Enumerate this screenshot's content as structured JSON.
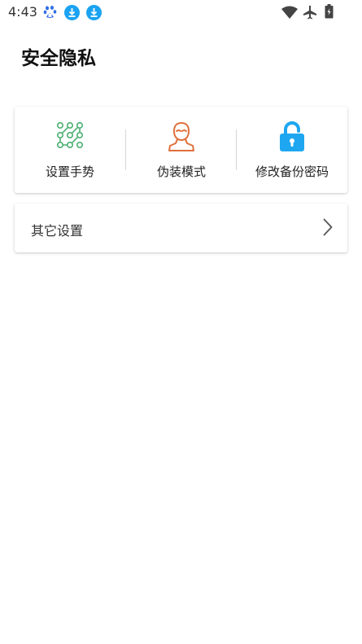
{
  "status_bar": {
    "time": "4:43"
  },
  "page": {
    "title": "安全隐私"
  },
  "actions": [
    {
      "label": "设置手势",
      "icon": "gesture-pattern-icon",
      "color": "#4caf72"
    },
    {
      "label": "伪装模式",
      "icon": "disguise-person-icon",
      "color": "#e0703a"
    },
    {
      "label": "修改备份密码",
      "icon": "unlock-icon",
      "color": "#1ea7f0"
    }
  ],
  "other_settings": {
    "label": "其它设置"
  },
  "colors": {
    "baidu_blue": "#2f6fe8",
    "download_blue": "#1aa3f2"
  }
}
